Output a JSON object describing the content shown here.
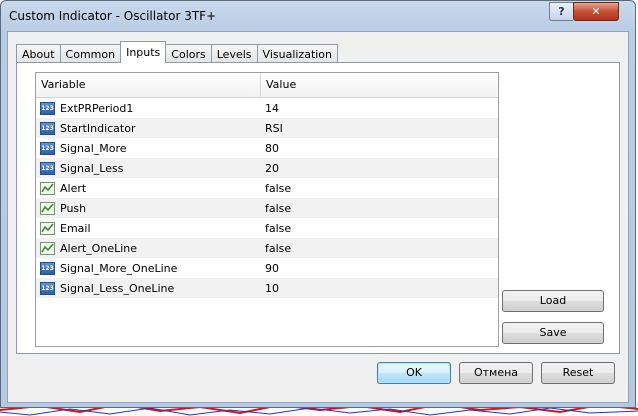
{
  "window": {
    "title": "Custom Indicator - Oscillator 3TF+",
    "help_label": "?",
    "close_label": "✕"
  },
  "tabs": [
    {
      "label": "About"
    },
    {
      "label": "Common"
    },
    {
      "label": "Inputs",
      "active": true
    },
    {
      "label": "Colors"
    },
    {
      "label": "Levels"
    },
    {
      "label": "Visualization"
    }
  ],
  "grid": {
    "headers": {
      "variable": "Variable",
      "value": "Value"
    },
    "rows": [
      {
        "icon": "number-icon",
        "variable": "ExtPRPeriod1",
        "value": "14"
      },
      {
        "icon": "number-icon",
        "variable": "StartIndicator",
        "value": "RSI"
      },
      {
        "icon": "number-icon",
        "variable": "Signal_More",
        "value": "80"
      },
      {
        "icon": "number-icon",
        "variable": "Signal_Less",
        "value": "20"
      },
      {
        "icon": "boolean-icon",
        "variable": "Alert",
        "value": "false"
      },
      {
        "icon": "boolean-icon",
        "variable": "Push",
        "value": "false"
      },
      {
        "icon": "boolean-icon",
        "variable": "Email",
        "value": "false"
      },
      {
        "icon": "boolean-icon",
        "variable": "Alert_OneLine",
        "value": "false"
      },
      {
        "icon": "number-icon",
        "variable": "Signal_More_OneLine",
        "value": "90"
      },
      {
        "icon": "number-icon",
        "variable": "Signal_Less_OneLine",
        "value": "10"
      }
    ],
    "number_icon_text": "123"
  },
  "buttons": {
    "load": "Load",
    "save": "Save",
    "ok": "OK",
    "cancel": "Отмена",
    "reset": "Reset"
  }
}
